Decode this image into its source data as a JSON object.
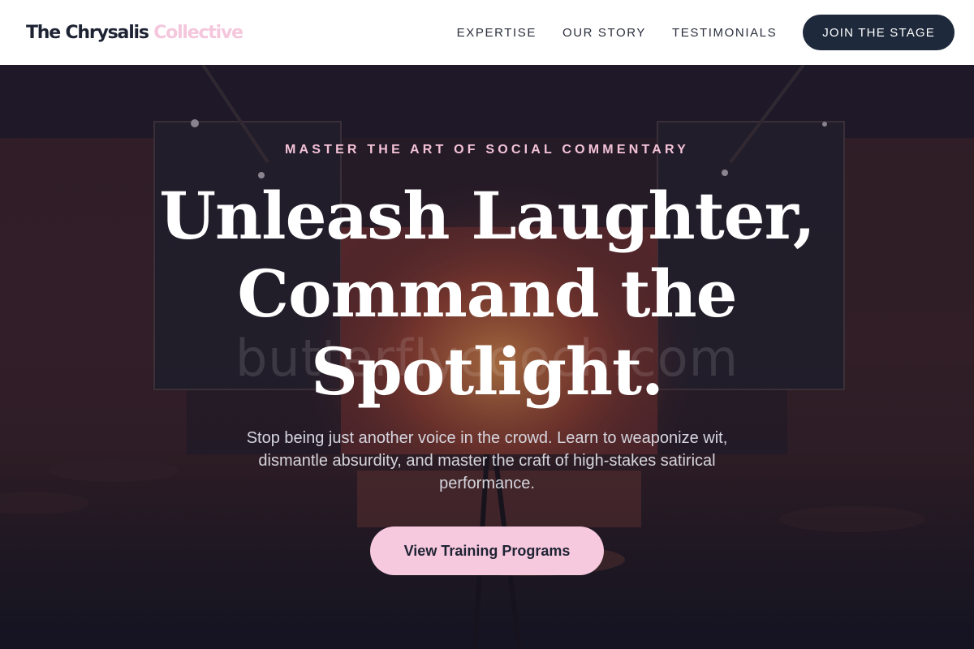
{
  "brand": {
    "name": "The Chrysalis",
    "accent": "Collective"
  },
  "nav": {
    "links": [
      "EXPERTISE",
      "OUR STORY",
      "TESTIMONIALS"
    ],
    "cta": "JOIN THE STAGE"
  },
  "hero": {
    "eyebrow": "MASTER THE ART OF SOCIAL COMMENTARY",
    "headline_line1": "Unleash Laughter,",
    "headline_line2": "Command the",
    "headline_line3": "Spotlight.",
    "subtext": "Stop being just another voice in the crowd. Learn to weaponize wit, dismantle absurdity, and master the craft of high-stakes satirical performance.",
    "cta": "View Training Programs",
    "watermark": "butterflycooch.com"
  },
  "colors": {
    "nav_bg": "#ffffff",
    "brand_dark": "#1e2334",
    "brand_accent": "#f4c7dc",
    "nav_cta_bg": "#1e293b",
    "hero_cta_bg": "#f7c9de",
    "eyebrow": "#f4c2d7"
  }
}
